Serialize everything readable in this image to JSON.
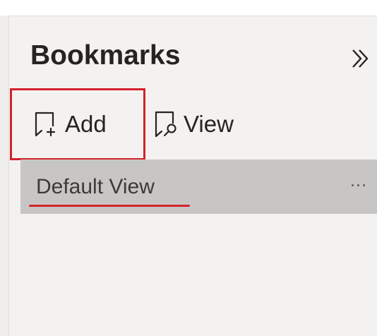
{
  "pane": {
    "title": "Bookmarks",
    "collapse_icon": "double-chevron-right-icon"
  },
  "toolbar": {
    "add": {
      "label": "Add",
      "icon": "bookmark-add-icon"
    },
    "view": {
      "label": "View",
      "icon": "bookmark-view-icon"
    }
  },
  "bookmarks": [
    {
      "name": "Default View",
      "selected": true,
      "more_icon": "ellipsis-icon"
    }
  ],
  "colors": {
    "highlight_red": "#d2232a",
    "selected_row": "#c8c6c4",
    "pane_background": "#f4f2f1",
    "text": "#252423"
  }
}
